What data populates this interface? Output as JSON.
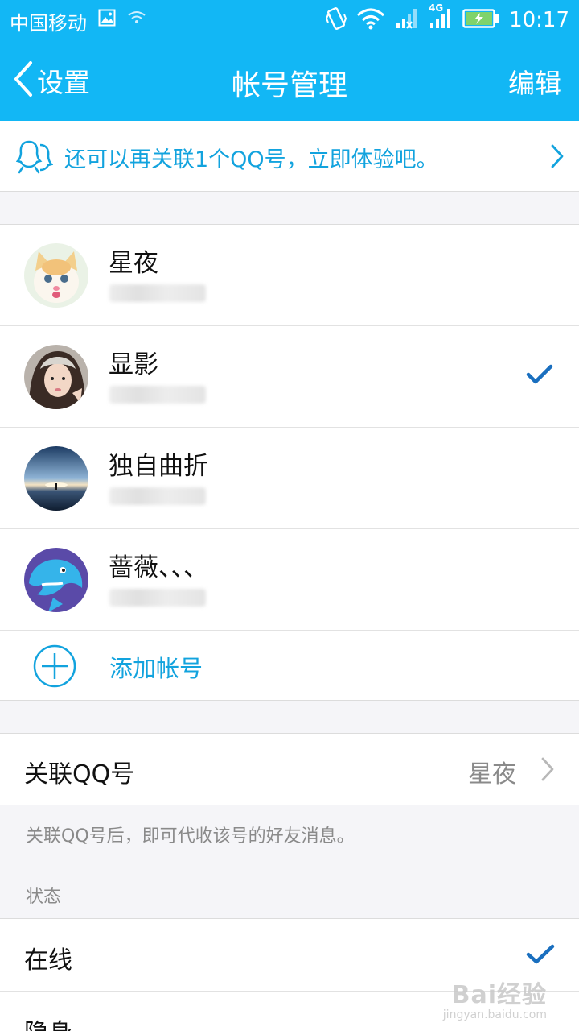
{
  "status_bar": {
    "carrier": "中国移动",
    "network": "4G",
    "time": "10:17"
  },
  "nav": {
    "back_label": "设置",
    "title": "帐号管理",
    "edit_label": "编辑"
  },
  "banner": {
    "text": "还可以再关联1个QQ号，立即体验吧。",
    "icon": "two-people-icon"
  },
  "accounts": [
    {
      "name": "星夜",
      "selected": false,
      "avatar": "kitten-avatar"
    },
    {
      "name": "显影",
      "selected": true,
      "avatar": "girl-avatar"
    },
    {
      "name": "独自曲折",
      "selected": false,
      "avatar": "sunset-avatar"
    },
    {
      "name": "蔷薇、、、",
      "selected": false,
      "avatar": "dolphin-avatar"
    }
  ],
  "add_account": {
    "label": "添加帐号"
  },
  "associated": {
    "label": "关联QQ号",
    "value": "星夜",
    "hint": "关联QQ号后，即可代收该号的好友消息。"
  },
  "status_section": {
    "label": "状态",
    "options": [
      {
        "label": "在线",
        "selected": true
      },
      {
        "label": "隐身",
        "selected": false
      }
    ]
  },
  "watermark": {
    "main": "Bai经验",
    "sub": "jingyan.baidu.com"
  },
  "colors": {
    "primary": "#12b7f5",
    "link": "#12a3de",
    "check": "#1a6fbf"
  }
}
